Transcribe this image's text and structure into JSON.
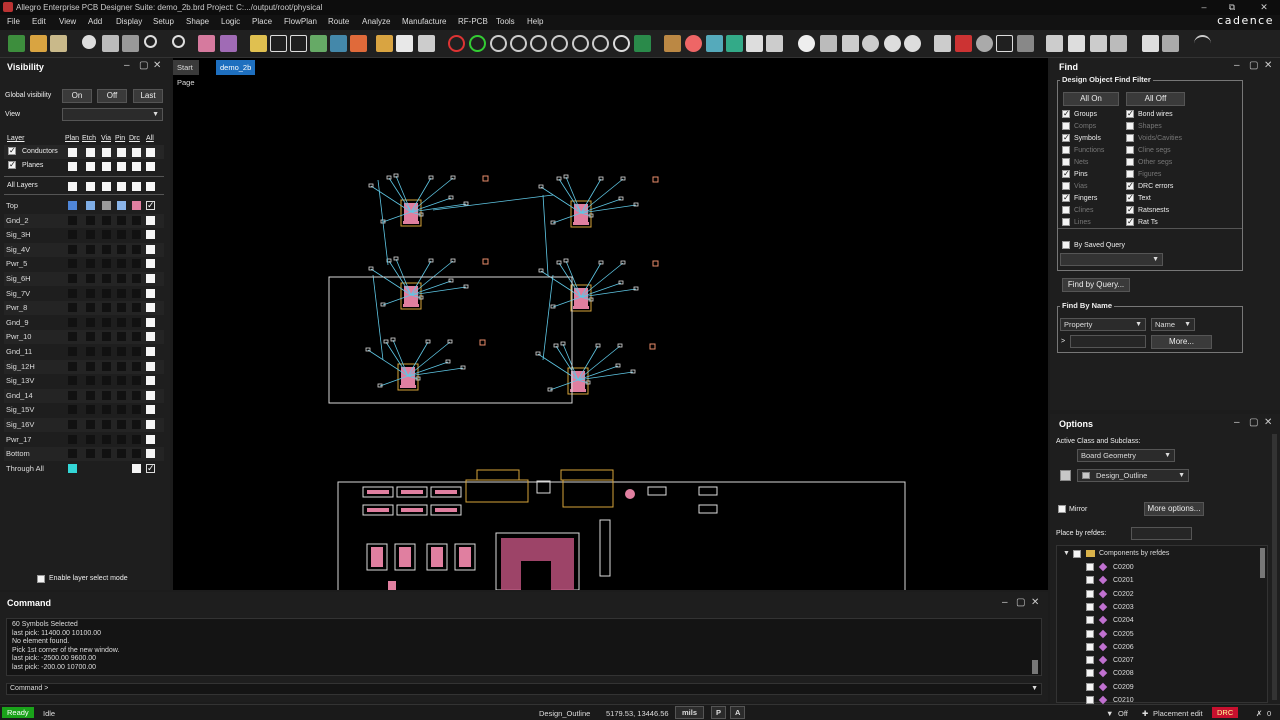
{
  "window": {
    "title": "Allegro Enterprise PCB Designer Suite: demo_2b.brd  Project: C:.../output/root/physical",
    "brand": "cadence"
  },
  "menu": [
    "File",
    "Edit",
    "View",
    "Add",
    "Display",
    "Setup",
    "Shape",
    "Logic",
    "Place",
    "FlowPlan",
    "Route",
    "Analyze",
    "Manufacture",
    "RF-PCB",
    "Tools",
    "Help"
  ],
  "visibility": {
    "title": "Visibility",
    "global_label": "Global visibility",
    "btn_on": "On",
    "btn_off": "Off",
    "btn_last": "Last",
    "view_label": "View",
    "view_value": "",
    "col_layer": "Layer",
    "col_plan": "Plan",
    "col_etch": "Etch",
    "col_via": "Via",
    "col_pin": "Pin",
    "col_drc": "Drc",
    "col_all": "All",
    "conductors": "Conductors",
    "planes": "Planes",
    "all_layers": "All Layers",
    "layers": [
      "Top",
      "Gnd_2",
      "Sig_3H",
      "Sig_4V",
      "Pwr_5",
      "Sig_6H",
      "Sig_7V",
      "Pwr_8",
      "Gnd_9",
      "Pwr_10",
      "Gnd_11",
      "Sig_12H",
      "Sig_13V",
      "Gnd_14",
      "Sig_15V",
      "Sig_16V",
      "Pwr_17",
      "Bottom",
      "Through All"
    ],
    "enable_select": "Enable layer select mode"
  },
  "tabs": [
    "Start Page",
    "demo_2b"
  ],
  "find": {
    "title": "Find",
    "filter_title": "Design Object Find Filter",
    "all_on": "All On",
    "all_off": "All Off",
    "left": [
      {
        "label": "Groups",
        "checked": true
      },
      {
        "label": "Comps",
        "checked": false
      },
      {
        "label": "Symbols",
        "checked": true
      },
      {
        "label": "Functions",
        "checked": false
      },
      {
        "label": "Nets",
        "checked": false
      },
      {
        "label": "Pins",
        "checked": true
      },
      {
        "label": "Vias",
        "checked": false
      },
      {
        "label": "Fingers",
        "checked": true
      },
      {
        "label": "Clines",
        "checked": false
      },
      {
        "label": "Lines",
        "checked": false
      }
    ],
    "right": [
      {
        "label": "Bond wires",
        "checked": true
      },
      {
        "label": "Shapes",
        "checked": false
      },
      {
        "label": "Voids/Cavities",
        "checked": false
      },
      {
        "label": "Cline segs",
        "checked": false
      },
      {
        "label": "Other segs",
        "checked": false
      },
      {
        "label": "Figures",
        "checked": false
      },
      {
        "label": "DRC errors",
        "checked": true
      },
      {
        "label": "Text",
        "checked": true
      },
      {
        "label": "Ratsnests",
        "checked": true
      },
      {
        "label": "Rat Ts",
        "checked": true
      }
    ],
    "by_saved_query": "By Saved Query",
    "find_by_query": "Find by Query...",
    "find_by_name": "Find By Name",
    "property": "Property",
    "name": "Name",
    "prompt": ">",
    "more": "More..."
  },
  "options": {
    "title": "Options",
    "active_class": "Active Class and Subclass:",
    "class_value": "Board Geometry",
    "subclass_value": "Design_Outline",
    "mirror": "Mirror",
    "more_options": "More options...",
    "place_by_refdes": "Place by refdes:",
    "tree_root": "Components by refdes",
    "refdes": [
      "C0200",
      "C0201",
      "C0202",
      "C0203",
      "C0204",
      "C0205",
      "C0206",
      "C0207",
      "C0208",
      "C0209",
      "C0210"
    ]
  },
  "command": {
    "title": "Command",
    "log": [
      "60 Symbols Selected",
      "last pick:  11400.00 10100.00",
      "No element found.",
      "Pick 1st corner of the new window.",
      "last pick:  -2500.00 9600.00",
      "last pick:  -200.00 10700.00"
    ],
    "prompt": "Command >"
  },
  "status": {
    "ready": "Ready",
    "idle": "Idle",
    "subclass": "Design_Outline",
    "coords": "5179.53, 13446.56",
    "units": "mils",
    "p": "P",
    "a": "A",
    "off": "Off",
    "placement_edit": "Placement edit",
    "drc": "DRC",
    "count": "0"
  },
  "colors": {
    "ready_bg": "#1aa31a",
    "drc_bg": "#c8102e",
    "tab_active": "#1e6fbf",
    "ratsnest": "#5fc8e6",
    "pad": "#e07fa0",
    "outline": "#d8d8d8"
  }
}
